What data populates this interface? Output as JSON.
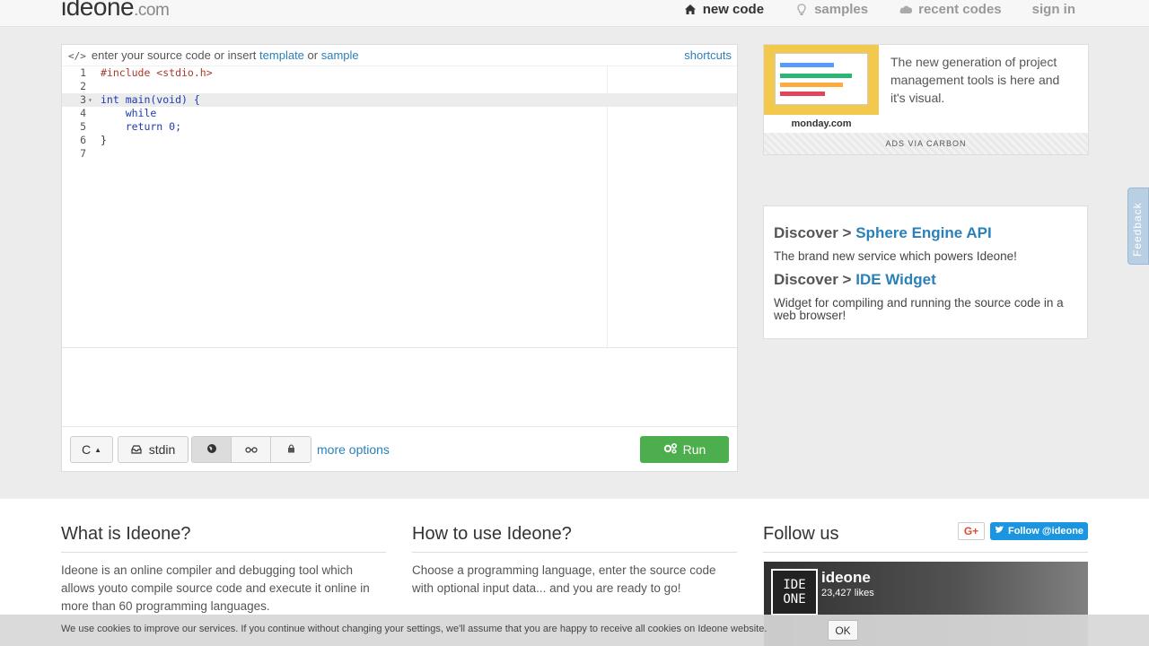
{
  "header": {
    "logo_main": "ideone",
    "logo_suffix": ".com",
    "nav": [
      {
        "label": "new code",
        "icon": "home-icon"
      },
      {
        "label": "samples",
        "icon": "lightbulb-icon"
      },
      {
        "label": "recent codes",
        "icon": "cloud-icon"
      },
      {
        "label": "sign in",
        "icon": ""
      }
    ]
  },
  "editor": {
    "hint_prefix": "enter your source code or insert",
    "hint_template": "template",
    "hint_or": "or",
    "hint_sample": "sample",
    "shortcuts": "shortcuts",
    "lines": [
      {
        "n": "1",
        "code": "#include <stdio.h>"
      },
      {
        "n": "2",
        "code": ""
      },
      {
        "n": "3",
        "code": "int main(void) {"
      },
      {
        "n": "4",
        "code": "    while"
      },
      {
        "n": "5",
        "code": "    return 0;"
      },
      {
        "n": "6",
        "code": "}"
      },
      {
        "n": "7",
        "code": ""
      }
    ],
    "language": "C",
    "stdin_label": "stdin",
    "more_options": "more options",
    "run_label": "Run"
  },
  "ad": {
    "brand": "monday.com",
    "text": "The new generation of project management tools is here and it's visual.",
    "footer": "ADS VIA CARBON"
  },
  "discover": {
    "item1_prefix": "Discover >",
    "item1_link": "Sphere Engine API",
    "item1_desc": "The brand new service which powers Ideone!",
    "item2_prefix": "Discover >",
    "item2_link": "IDE Widget",
    "item2_desc": "Widget for compiling and running the source code in a web browser!"
  },
  "feedback_label": "Feedback",
  "bottom": {
    "what_title": "What is Ideone?",
    "what_text": "Ideone is an online compiler and debugging tool which allows youto compile source code and execute it online in more than 60 programming languages.",
    "how_title": "How to use Ideone?",
    "how_text": "Choose a programming language, enter the source code with optional input data... and you are ready to go!",
    "follow_title": "Follow us",
    "gplus": "G+",
    "twitter": "Follow @ideone",
    "fb_name": "ideone",
    "fb_likes": "23,427 likes"
  },
  "cookie": {
    "text": "We use cookies to improve our services. If you continue without changing your settings, we'll assume that you are happy to receive all cookies on Ideone website.",
    "ok": "OK"
  }
}
